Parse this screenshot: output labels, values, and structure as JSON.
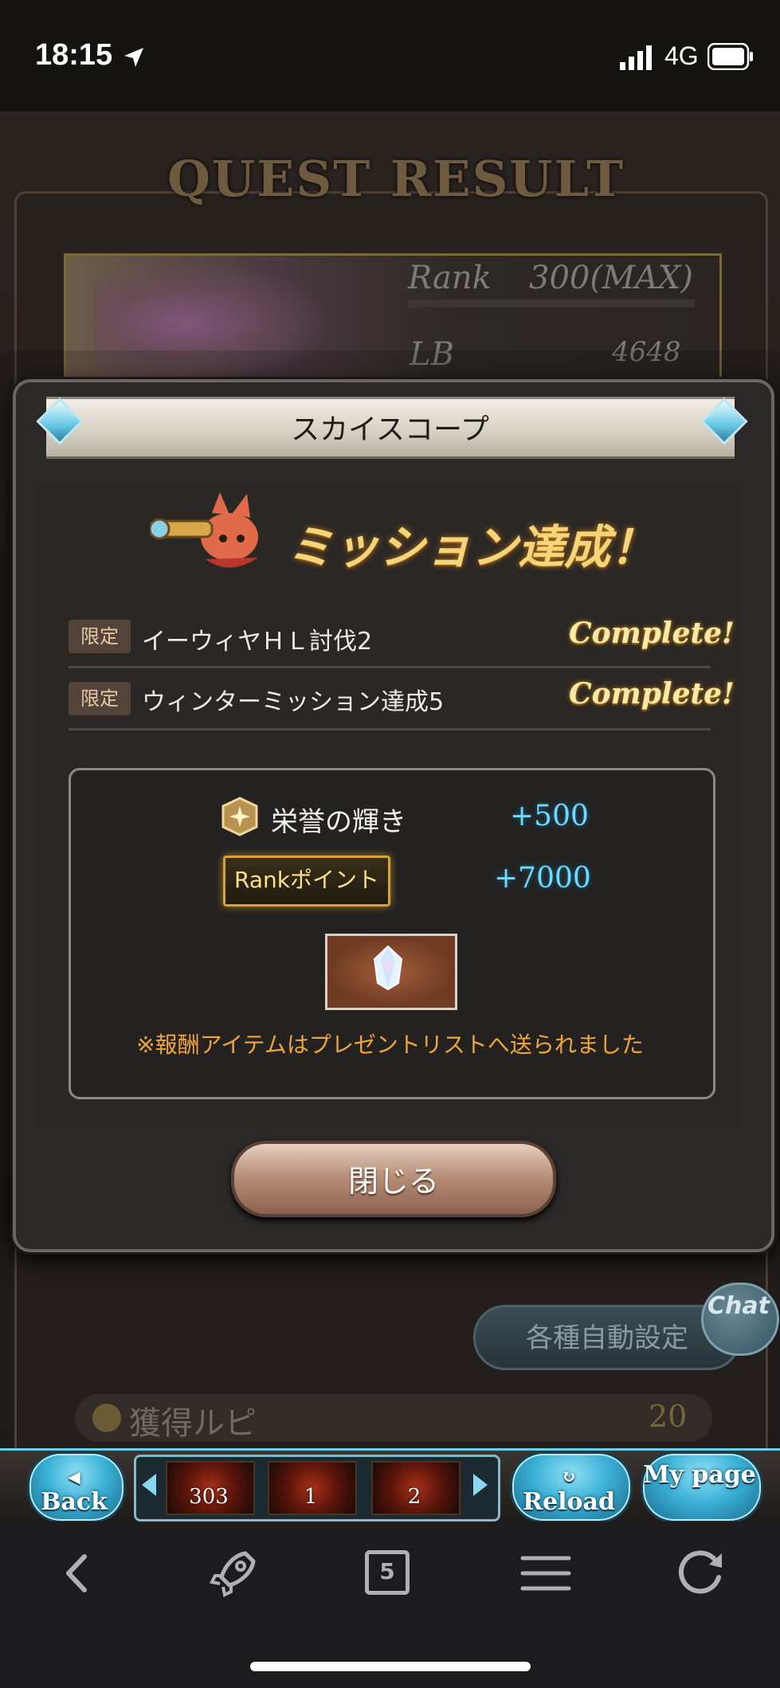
{
  "status": {
    "time": "18:15",
    "network": "4G"
  },
  "background": {
    "header": "QUEST RESULT",
    "rank_label": "Rank",
    "rank_value": "300(MAX)",
    "lb_label": "LB",
    "lb_value": "4648",
    "auto_settings": "各種自動設定",
    "chat": "Chat",
    "rupee_label": "獲得ルピ",
    "rupee_value": "20"
  },
  "popup": {
    "title": "スカイスコープ",
    "mission_heading": "ミッション達成！",
    "missions": [
      {
        "badge": "限定",
        "name": "イーウィヤＨＬ討伐2",
        "status": "Complete!"
      },
      {
        "badge": "限定",
        "name": "ウィンターミッション達成5",
        "status": "Complete!"
      }
    ],
    "rewards": {
      "honor_label": "栄誉の輝き",
      "honor_value": "+500",
      "rank_point_label": "Rankポイント",
      "rank_point_value": "+7000",
      "notice": "※報酬アイテムはプレゼントリストへ送られました"
    },
    "close_label": "閉じる"
  },
  "game_nav": {
    "back_label": "Back",
    "reload_label": "Reload",
    "mypage_label": "My page",
    "items": [
      {
        "count": "303",
        "icon": "green-item-icon"
      },
      {
        "count": "1",
        "icon": "red-item-icon"
      },
      {
        "count": "2",
        "icon": "purple-item-icon"
      }
    ]
  },
  "browser": {
    "tabs_count": "5"
  },
  "colors": {
    "accent_blue": "#6fd9ff",
    "complete_gold": "#ffe9a8",
    "notice_orange": "#f0a53a"
  }
}
